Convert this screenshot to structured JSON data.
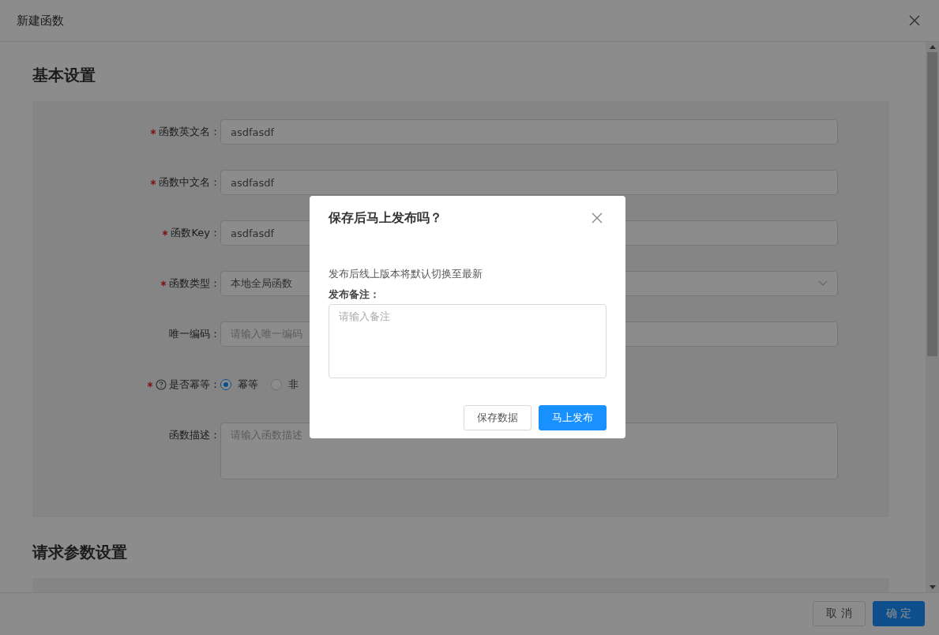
{
  "window": {
    "title": "新建函数"
  },
  "sections": [
    {
      "title": "基本设置",
      "fields": [
        {
          "kind": "input",
          "required": true,
          "help": false,
          "label": "函数英文名：",
          "value": "asdfasdf"
        },
        {
          "kind": "input",
          "required": true,
          "help": false,
          "label": "函数中文名：",
          "value": "asdfasdf"
        },
        {
          "kind": "input",
          "required": true,
          "help": false,
          "label": "函数Key：",
          "value": "asdfasdf"
        },
        {
          "kind": "select",
          "required": true,
          "help": false,
          "label": "函数类型：",
          "value": "本地全局函数"
        },
        {
          "kind": "input",
          "required": false,
          "help": false,
          "label": "唯一编码：",
          "placeholder": "请输入唯一编码"
        },
        {
          "kind": "radio",
          "required": true,
          "help": true,
          "label": "是否幂等：",
          "options": [
            {
              "label": "幂等",
              "selected": true
            },
            {
              "label": "非",
              "selected": false
            }
          ]
        },
        {
          "kind": "textarea",
          "required": false,
          "help": false,
          "label": "函数描述：",
          "placeholder": "请输入函数描述"
        }
      ]
    },
    {
      "title": "请求参数设置"
    }
  ],
  "footer": {
    "buttons": [
      {
        "label": "取 消",
        "kind": "default"
      },
      {
        "label": "确 定",
        "kind": "primary"
      }
    ]
  },
  "dialog": {
    "title": "保存后马上发布吗？",
    "message": "发布后线上版本将默认切换至最新",
    "note_label": "发布备注：",
    "note_placeholder": "请输入备注",
    "buttons": [
      {
        "label": "保存数据",
        "kind": "default"
      },
      {
        "label": "马上发布",
        "kind": "primary"
      }
    ]
  }
}
